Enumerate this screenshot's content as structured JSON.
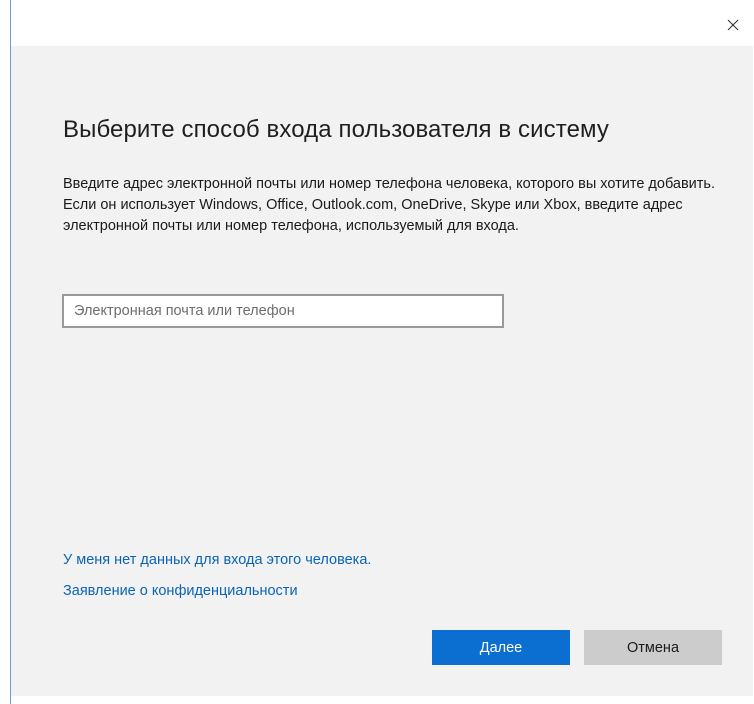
{
  "window": {
    "close_icon": "close-icon"
  },
  "dialog": {
    "heading": "Выберите способ входа пользователя в систему",
    "description": "Введите адрес электронной почты или номер телефона человека, которого вы хотите добавить. Если он использует Windows, Office, Outlook.com, OneDrive, Skype или Xbox, введите адрес электронной почты или номер телефона, используемый для входа.",
    "email_input": {
      "value": "",
      "placeholder": "Электронная почта или телефон"
    },
    "links": {
      "no_signin_info": "У меня нет данных для входа этого человека.",
      "privacy": "Заявление о конфиденциальности"
    },
    "buttons": {
      "next": "Далее",
      "cancel": "Отмена"
    }
  },
  "colors": {
    "accent": "#0a6fd0",
    "link": "#0a64b4",
    "panel_bg": "#f2f2f2",
    "secondary_button": "#cccccc"
  }
}
